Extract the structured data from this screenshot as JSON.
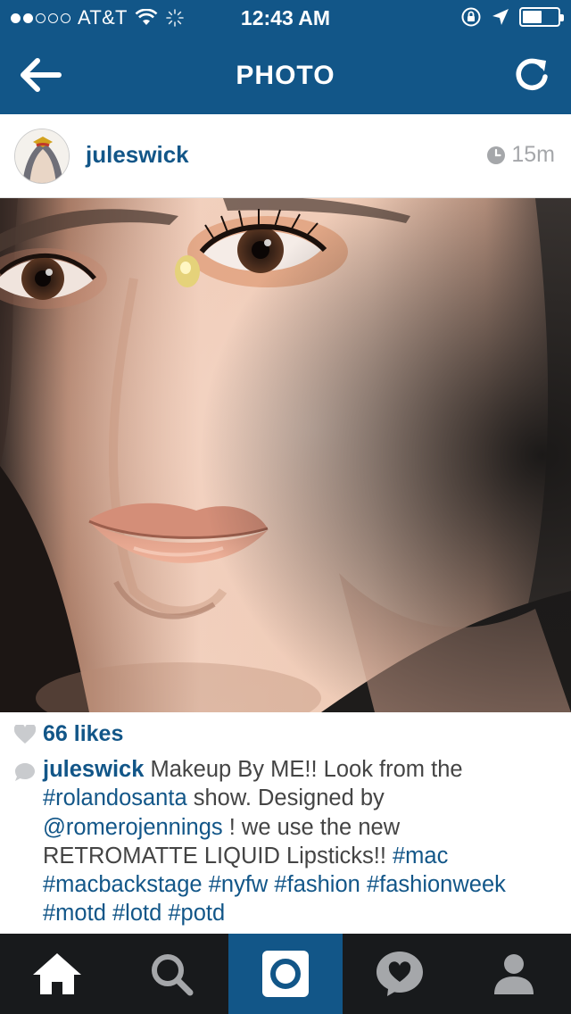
{
  "status_bar": {
    "carrier": "AT&T",
    "time": "12:43 AM",
    "signal_bars_filled": 2,
    "signal_bars_total": 5,
    "battery_level": 0.55
  },
  "nav": {
    "title": "PHOTO",
    "back_icon": "arrow-left-icon",
    "refresh_icon": "refresh-icon"
  },
  "post": {
    "username": "juleswick",
    "time_ago": "15m",
    "likes": "66 likes",
    "caption": {
      "username": "juleswick",
      "text1": " Makeup By ME!! Look from the ",
      "tag_rolandosanta": "#rolandosanta",
      "text2": " show. Designed by ",
      "mention": "@romerojennings",
      "text3": " ! we use the new RETROMATTE LIQUID Lipsticks!! ",
      "tag_mac": "#mac",
      "tag_macbackstage": "#macbackstage",
      "tag_nyfw": "#nyfw",
      "tag_fashion": "#fashion",
      "tag_fashionweek": "#fashionweek",
      "tag_motd": "#motd",
      "tag_lotd": "#lotd",
      "tag_potd": "#potd"
    }
  },
  "tabs": [
    {
      "name": "home",
      "icon": "home-icon",
      "active": false
    },
    {
      "name": "explore",
      "icon": "search-icon",
      "active": false
    },
    {
      "name": "camera",
      "icon": "camera-icon",
      "active": true
    },
    {
      "name": "activity",
      "icon": "activity-heart-icon",
      "active": false
    },
    {
      "name": "profile",
      "icon": "profile-icon",
      "active": false
    }
  ],
  "colors": {
    "brand_blue": "#125688",
    "tabbar_dark": "#181a1c",
    "muted_gray": "#a5a7aa"
  }
}
